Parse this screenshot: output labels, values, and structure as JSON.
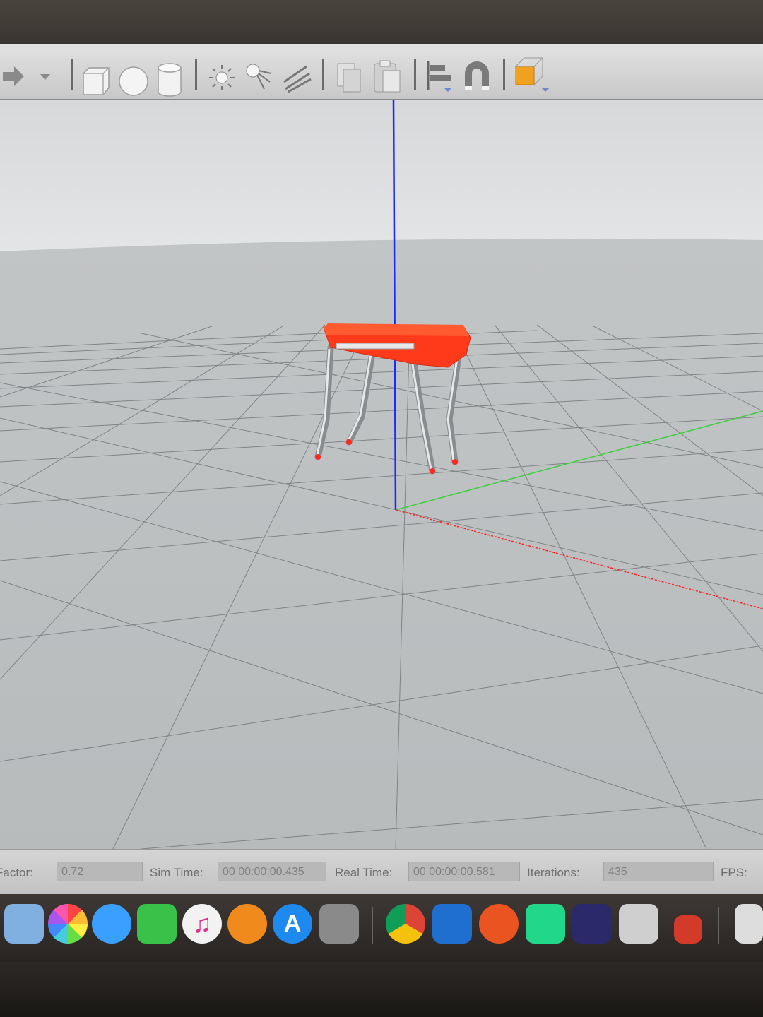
{
  "toolbar": {
    "items": [
      {
        "icon": "redo-arrow-icon"
      },
      {
        "icon": "dropdown-arrow-icon"
      },
      {
        "icon": "box-shape-icon"
      },
      {
        "icon": "sphere-shape-icon"
      },
      {
        "icon": "cylinder-shape-icon"
      },
      {
        "icon": "point-light-icon"
      },
      {
        "icon": "spot-light-icon"
      },
      {
        "icon": "directional-light-icon"
      },
      {
        "icon": "copy-icon"
      },
      {
        "icon": "paste-icon"
      },
      {
        "icon": "align-icon"
      },
      {
        "icon": "snap-magnet-icon"
      },
      {
        "icon": "view-angle-cube-icon"
      }
    ]
  },
  "status": {
    "factor_label": "Factor:",
    "factor_value": "0.72",
    "sim_time_label": "Sim Time:",
    "sim_time_value": "00 00:00:00.435",
    "real_time_label": "Real Time:",
    "real_time_value": "00 00:00:00.581",
    "iterations_label": "Iterations:",
    "iterations_value": "435",
    "fps_label": "FPS:"
  },
  "colors": {
    "robot_body": "#ff3a1a",
    "z_axis": "#1a2aff",
    "y_axis": "#3ccf3c",
    "x_axis": "#ff2020"
  },
  "dock": {
    "apps": [
      {
        "icon": "maps-icon",
        "color": "#7fb0e0"
      },
      {
        "icon": "photos-icon",
        "color": "#f4f4f4"
      },
      {
        "icon": "messages-icon",
        "color": "#3aa0ff"
      },
      {
        "icon": "facetime-icon",
        "color": "#39c24a"
      },
      {
        "icon": "itunes-icon",
        "color": "#f2f2f2"
      },
      {
        "icon": "books-icon",
        "color": "#f08a1c"
      },
      {
        "icon": "app-store-icon",
        "color": "#1e8af0"
      },
      {
        "icon": "system-preferences-icon",
        "color": "#8a8a8a"
      },
      {
        "icon": "chrome-icon",
        "color": "#e8e8e8"
      },
      {
        "icon": "windows-vm-icon",
        "color": "#1f6fd1"
      },
      {
        "icon": "ubuntu-vm-icon",
        "color": "#e95420"
      },
      {
        "icon": "pycharm-icon",
        "color": "#21d789"
      },
      {
        "icon": "robot-sim-icon",
        "color": "#2a2a6a"
      },
      {
        "icon": "archive-utility-icon",
        "color": "#cfcfcf"
      },
      {
        "icon": "parallels-icon",
        "color": "#d43a2a"
      },
      {
        "icon": "documents-stack-icon",
        "color": "#dddddd"
      }
    ]
  }
}
